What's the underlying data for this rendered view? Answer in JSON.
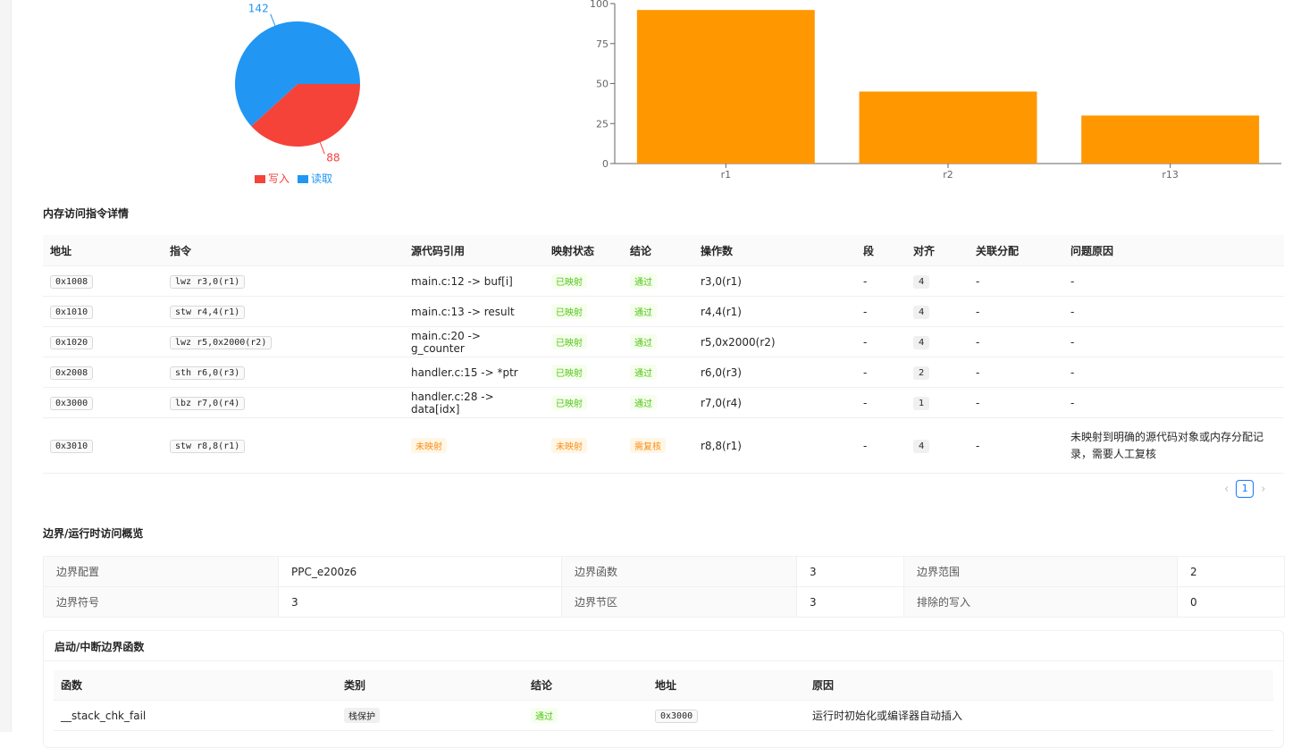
{
  "colors": {
    "write": "#f5433a",
    "read": "#2196f3",
    "bar": "#ff9800",
    "success": "#52c41a",
    "warning": "#fa8c16",
    "link": "#1677ff"
  },
  "chart_data": [
    {
      "type": "pie",
      "slices": [
        {
          "name": "写入",
          "value": 88,
          "color": "#f5433a"
        },
        {
          "name": "读取",
          "value": 142,
          "color": "#2196f3"
        }
      ],
      "legend": [
        "写入",
        "读取"
      ],
      "legend_position": "bottom"
    },
    {
      "type": "bar",
      "categories": [
        "r1",
        "r2",
        "r13"
      ],
      "values": [
        96,
        45,
        30
      ],
      "yticks": [
        0,
        25,
        50,
        75,
        100
      ],
      "ylim": [
        0,
        100
      ],
      "color": "#ff9800"
    }
  ],
  "mem_section_title": "内存访问指令详情",
  "mem_table": {
    "headers": [
      "地址",
      "指令",
      "源代码引用",
      "映射状态",
      "结论",
      "操作数",
      "段",
      "对齐",
      "关联分配",
      "问题原因"
    ],
    "rows": [
      {
        "addr": "0x1008",
        "instr": "lwz r3,0(r1)",
        "src": "main.c:12 -> buf[i]",
        "map": "已映射",
        "verdict": "通过",
        "operand": "r3,0(r1)",
        "seg": "-",
        "align": "4",
        "alloc": "-",
        "reason": "-"
      },
      {
        "addr": "0x1010",
        "instr": "stw r4,4(r1)",
        "src": "main.c:13 -> result",
        "map": "已映射",
        "verdict": "通过",
        "operand": "r4,4(r1)",
        "seg": "-",
        "align": "4",
        "alloc": "-",
        "reason": "-"
      },
      {
        "addr": "0x1020",
        "instr": "lwz r5,0x2000(r2)",
        "src": "main.c:20 -> g_counter",
        "map": "已映射",
        "verdict": "通过",
        "operand": "r5,0x2000(r2)",
        "seg": "-",
        "align": "4",
        "alloc": "-",
        "reason": "-"
      },
      {
        "addr": "0x2008",
        "instr": "sth r6,0(r3)",
        "src": "handler.c:15 -> *ptr",
        "map": "已映射",
        "verdict": "通过",
        "operand": "r6,0(r3)",
        "seg": "-",
        "align": "2",
        "alloc": "-",
        "reason": "-"
      },
      {
        "addr": "0x3000",
        "instr": "lbz r7,0(r4)",
        "src": "handler.c:28 -> data[idx]",
        "map": "已映射",
        "verdict": "通过",
        "operand": "r7,0(r4)",
        "seg": "-",
        "align": "1",
        "alloc": "-",
        "reason": "-"
      },
      {
        "addr": "0x3010",
        "instr": "stw r8,8(r1)",
        "src": "未映射",
        "map": "未映射",
        "verdict": "需复核",
        "operand": "r8,8(r1)",
        "seg": "-",
        "align": "4",
        "alloc": "-",
        "reason": "未映射到明确的源代码对象或内存分配记录，需要人工复核"
      }
    ]
  },
  "pagination": {
    "prev": "‹",
    "current": "1",
    "next": "›"
  },
  "boundary_section_title": "边界/运行时访问概览",
  "boundary_desc": {
    "row1": [
      {
        "label": "边界配置",
        "value": "PPC_e200z6"
      },
      {
        "label": "边界函数",
        "value": "3"
      },
      {
        "label": "边界范围",
        "value": "2"
      }
    ],
    "row2": [
      {
        "label": "边界符号",
        "value": "3"
      },
      {
        "label": "边界节区",
        "value": "3"
      },
      {
        "label": "排除的写入",
        "value": "0"
      }
    ]
  },
  "boundary_card": {
    "title": "启动/中断边界函数",
    "headers": [
      "函数",
      "类别",
      "结论",
      "地址",
      "原因"
    ],
    "rows": [
      {
        "func": "__stack_chk_fail",
        "category": "栈保护",
        "verdict": "通过",
        "addr": "0x3000",
        "reason": "运行时初始化或编译器自动插入"
      }
    ]
  }
}
